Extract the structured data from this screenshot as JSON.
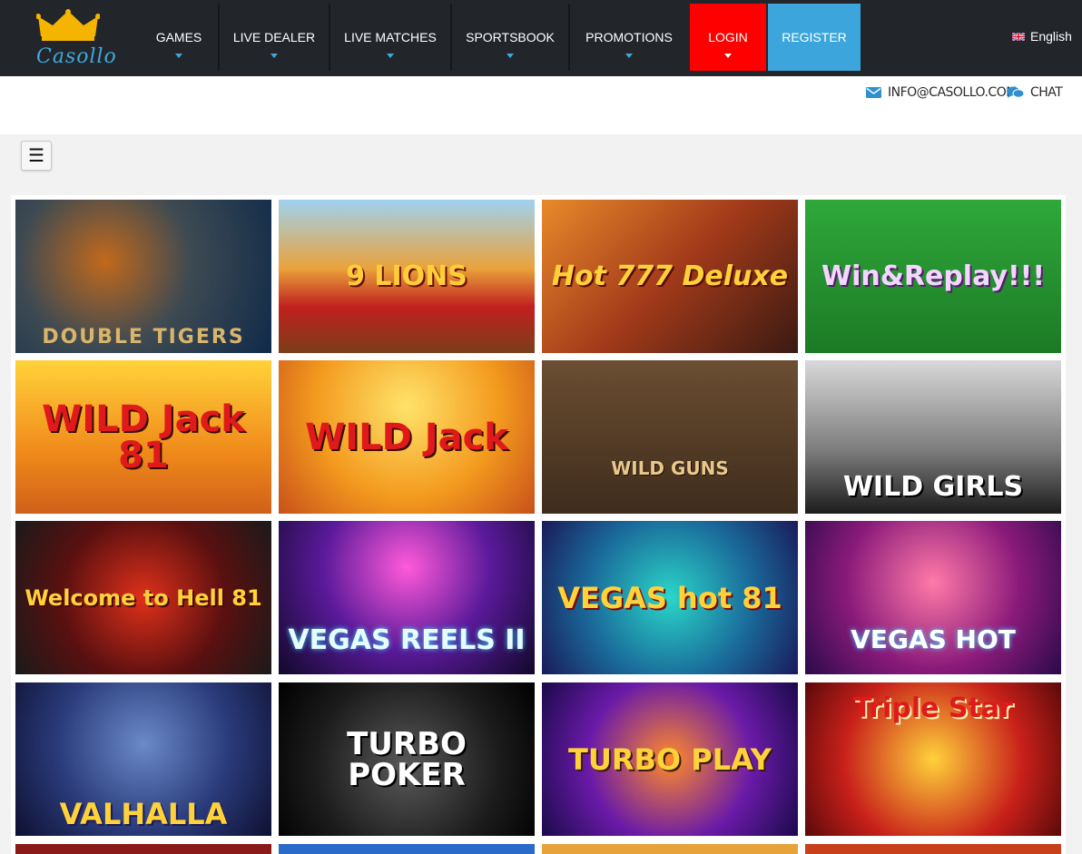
{
  "brand": {
    "name": "Casollo"
  },
  "nav": {
    "items": [
      {
        "label": "GAMES"
      },
      {
        "label": "LIVE DEALER"
      },
      {
        "label": "LIVE MATCHES"
      },
      {
        "label": "SPORTSBOOK"
      },
      {
        "label": "PROMOTIONS"
      }
    ],
    "login_label": "LOGIN",
    "register_label": "REGISTER",
    "language": "English"
  },
  "contact": {
    "email": "INFO@CASOLLO.COM",
    "chat_label": "CHAT"
  },
  "menu_button_icon": "hamburger-icon",
  "colors": {
    "topbar": "#22262b",
    "accent_blue": "#3ca6dc",
    "login_red": "#ff0000",
    "gold": "#f5b400"
  },
  "games": [
    {
      "title": "DOUBLE TIGERS"
    },
    {
      "title": "9 LIONS"
    },
    {
      "title": "Hot 777 Deluxe"
    },
    {
      "title": "Win&Replay!!!"
    },
    {
      "title": "WILD Jack 81"
    },
    {
      "title": "WILD Jack"
    },
    {
      "title": "WILD GUNS"
    },
    {
      "title": "WILD GIRLS"
    },
    {
      "title": "Welcome to Hell 81"
    },
    {
      "title": "VEGAS REELS II"
    },
    {
      "title": "VEGAS hot 81"
    },
    {
      "title": "VEGAS HOT"
    },
    {
      "title": "VALHALLA"
    },
    {
      "title": "TURBO POKER"
    },
    {
      "title": "TURBO PLAY"
    },
    {
      "title": "Triple Star"
    }
  ]
}
